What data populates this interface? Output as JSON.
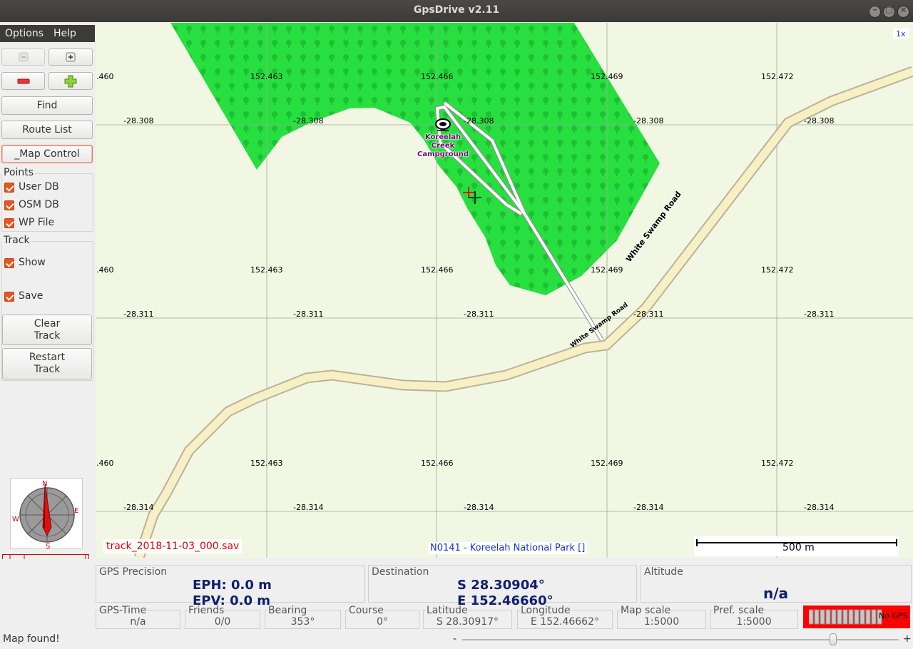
{
  "window": {
    "title": "GpsDrive v2.11"
  },
  "menu": {
    "options": "Options",
    "help": "Help"
  },
  "toolbar": {
    "zoom_out_label": "Zoom out",
    "zoom_in_label": "Zoom in",
    "scale_down_label": "Scale down",
    "scale_up_label": "Scale up",
    "find_label": "Find",
    "route_list_label": "Route List",
    "map_control_label": "_Map Control"
  },
  "points": {
    "title": "Points",
    "items": [
      {
        "label": "User DB",
        "checked": true
      },
      {
        "label": "OSM DB",
        "checked": true
      },
      {
        "label": "WP File",
        "checked": true
      }
    ]
  },
  "track": {
    "title": "Track",
    "show_label": "Show",
    "save_label": "Save",
    "clear_label_1": "Clear",
    "clear_label_2": "Track",
    "restart_label_1": "Restart",
    "restart_label_2": "Track"
  },
  "compass": {
    "n": "N",
    "s": "S",
    "e": "E",
    "w": "W"
  },
  "map": {
    "zoom_indicator": "1x",
    "track_file": "track_2018-11-03_000.sav",
    "area_name": "N0141 - Koreelah National Park []",
    "scale_bar_label": "500 m",
    "poi_label_1": "Koreelah",
    "poi_label_2": "Creek",
    "poi_label_3": "Campground",
    "road_name": "White Swamp Road",
    "lon_labels": [
      ".460",
      "152.463",
      "152.466",
      "152.469",
      "152.472"
    ],
    "lat_labels": [
      "-28.308",
      "-28.311",
      "-28.314"
    ],
    "colors": {
      "forest": "#27e040",
      "road": "#f6f0c4",
      "road_casing": "#b9b29a",
      "background": "#f2f7e4"
    }
  },
  "info": {
    "gps_precision": {
      "label": "GPS Precision",
      "eph": "EPH: 0.0 m",
      "epv": "EPV: 0.0 m"
    },
    "destination": {
      "label": "Destination",
      "lat": "S 28.30904°",
      "lon": "E 152.46660°"
    },
    "altitude": {
      "label": "Altitude",
      "value": "n/a"
    },
    "gps_time": {
      "label": "GPS-Time",
      "value": "n/a"
    },
    "friends": {
      "label": "Friends",
      "value": "0/0"
    },
    "bearing": {
      "label": "Bearing",
      "value": "353°"
    },
    "course": {
      "label": "Course",
      "value": "0°"
    },
    "latitude": {
      "label": "Latitude",
      "value": "S 28.30917°"
    },
    "longitude": {
      "label": "Longitude",
      "value": "E 152.46662°"
    },
    "map_scale": {
      "label": "Map scale",
      "value": "1:5000"
    },
    "pref_scale": {
      "label": "Pref. scale",
      "value": "1:5000"
    },
    "gps_status": "No GPS"
  },
  "statusbar": {
    "message": "Map found!",
    "minus": "-",
    "plus": "+",
    "slider_value": 0.85
  }
}
